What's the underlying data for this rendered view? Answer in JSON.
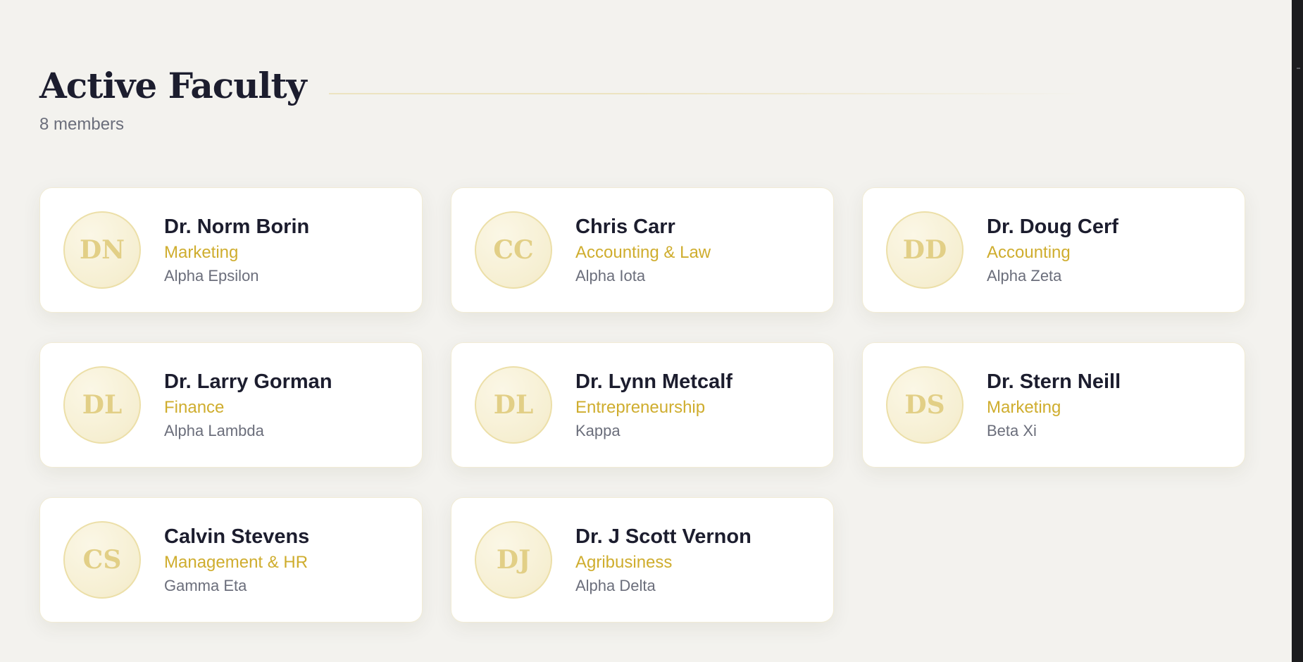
{
  "header": {
    "title": "Active Faculty",
    "count_label": "8 members"
  },
  "colors": {
    "background": "#f3f2ee",
    "card": "#ffffff",
    "title": "#1c1d2e",
    "accent_gold": "#cfad2e",
    "avatar_initials": "#e2cf86",
    "muted": "#6b6e7b"
  },
  "faculty": [
    {
      "initials": "DN",
      "name": "Dr. Norm Borin",
      "department": "Marketing",
      "chapter": "Alpha Epsilon"
    },
    {
      "initials": "CC",
      "name": "Chris Carr",
      "department": "Accounting & Law",
      "chapter": "Alpha Iota"
    },
    {
      "initials": "DD",
      "name": "Dr. Doug Cerf",
      "department": "Accounting",
      "chapter": "Alpha Zeta"
    },
    {
      "initials": "DL",
      "name": "Dr. Larry Gorman",
      "department": "Finance",
      "chapter": "Alpha Lambda"
    },
    {
      "initials": "DL",
      "name": "Dr. Lynn Metcalf",
      "department": "Entrepreneurship",
      "chapter": "Kappa"
    },
    {
      "initials": "DS",
      "name": "Dr. Stern Neill",
      "department": "Marketing",
      "chapter": "Beta Xi"
    },
    {
      "initials": "CS",
      "name": "Calvin Stevens",
      "department": "Management & HR",
      "chapter": "Gamma Eta"
    },
    {
      "initials": "DJ",
      "name": "Dr. J Scott Vernon",
      "department": "Agribusiness",
      "chapter": "Alpha Delta"
    }
  ]
}
